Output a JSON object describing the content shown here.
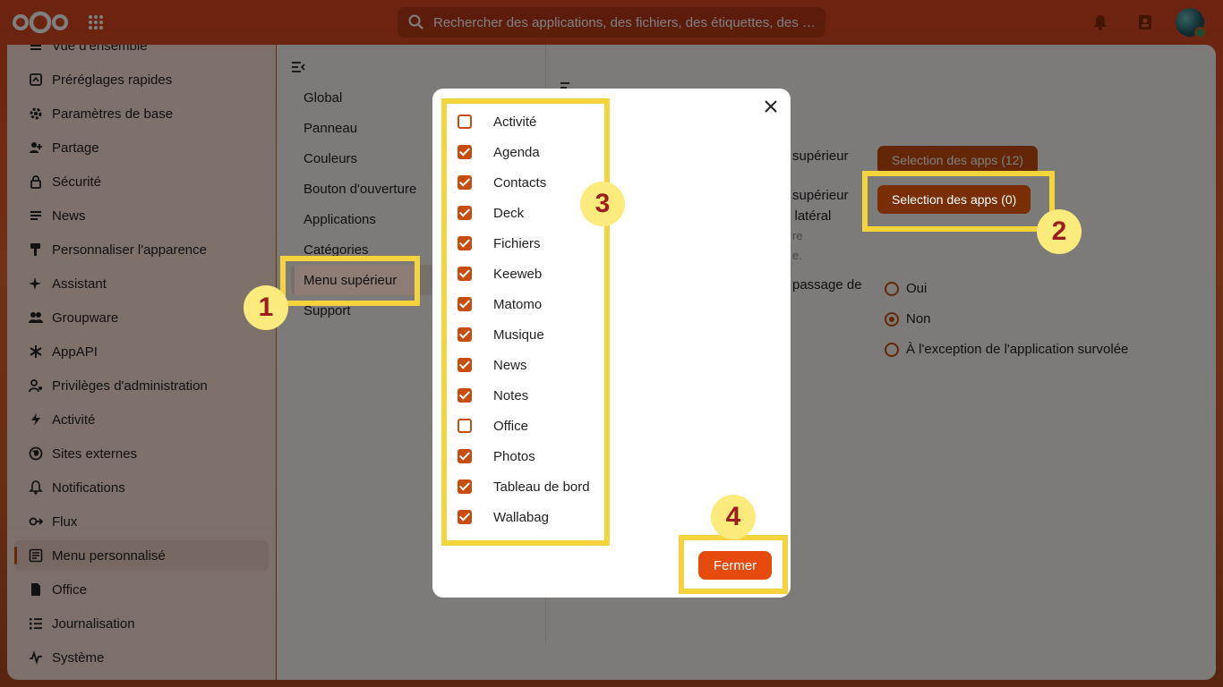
{
  "header": {
    "search_placeholder": "Rechercher des applications, des fichiers, des étiquettes, des …",
    "icons": [
      "nextcloud-logo",
      "apps-grid-icon",
      "search-icon",
      "notifications-icon",
      "contacts-icon",
      "user-avatar"
    ]
  },
  "sidebar": {
    "items": [
      {
        "label": "Vue d'ensemble",
        "icon": "list-icon"
      },
      {
        "label": "Préréglages rapides",
        "icon": "presets-icon"
      },
      {
        "label": "Paramètres de base",
        "icon": "gear-icon"
      },
      {
        "label": "Partage",
        "icon": "share-icon"
      },
      {
        "label": "Sécurité",
        "icon": "lock-icon"
      },
      {
        "label": "News",
        "icon": "news-icon"
      },
      {
        "label": "Personnaliser l'apparence",
        "icon": "paint-icon"
      },
      {
        "label": "Assistant",
        "icon": "sparkle-icon"
      },
      {
        "label": "Groupware",
        "icon": "group-icon"
      },
      {
        "label": "AppAPI",
        "icon": "api-icon"
      },
      {
        "label": "Privilèges d'administration",
        "icon": "admin-icon"
      },
      {
        "label": "Activité",
        "icon": "bolt-icon"
      },
      {
        "label": "Sites externes",
        "icon": "globe-icon"
      },
      {
        "label": "Notifications",
        "icon": "bell-icon"
      },
      {
        "label": "Flux",
        "icon": "flow-icon"
      },
      {
        "label": "Menu personnalisé",
        "icon": "menu-icon"
      },
      {
        "label": "Office",
        "icon": "document-icon"
      },
      {
        "label": "Journalisation",
        "icon": "log-icon"
      },
      {
        "label": "Système",
        "icon": "pulse-icon"
      }
    ],
    "active": "Menu personnalisé"
  },
  "settings_nav": {
    "items": [
      "Global",
      "Panneau",
      "Couleurs",
      "Bouton d'ouverture",
      "Applications",
      "Catégories",
      "Menu supérieur",
      "Support"
    ],
    "active": "Menu supérieur"
  },
  "content": {
    "row1_label": "supérieur",
    "row1_button": "Selection des apps (12)",
    "row2_label_a": "supérieur",
    "row2_label_b": "u latéral",
    "row2_sub_a": "re",
    "row2_sub_b": "e.",
    "row2_button": "Selection des apps (0)",
    "row3_label_a": "passage de",
    "radios": [
      {
        "label": "Oui",
        "checked": false
      },
      {
        "label": "Non",
        "checked": true
      },
      {
        "label": "À l'exception de l'application survolée",
        "checked": false
      }
    ]
  },
  "modal": {
    "apps": [
      {
        "label": "Activité",
        "checked": false
      },
      {
        "label": "Agenda",
        "checked": true
      },
      {
        "label": "Contacts",
        "checked": true
      },
      {
        "label": "Deck",
        "checked": true
      },
      {
        "label": "Fichiers",
        "checked": true
      },
      {
        "label": "Keeweb",
        "checked": true
      },
      {
        "label": "Matomo",
        "checked": true
      },
      {
        "label": "Musique",
        "checked": true
      },
      {
        "label": "News",
        "checked": true
      },
      {
        "label": "Notes",
        "checked": true
      },
      {
        "label": "Office",
        "checked": false
      },
      {
        "label": "Photos",
        "checked": true
      },
      {
        "label": "Tableau de bord",
        "checked": true
      },
      {
        "label": "Wallabag",
        "checked": true
      }
    ],
    "close_button": "Fermer"
  },
  "annotations": {
    "badge1": "1",
    "badge2": "2",
    "badge3": "3",
    "badge4": "4",
    "highlight_color": "#f5d33d"
  },
  "colors": {
    "accent": "#c74d0d",
    "close_button": "#e64a0c"
  }
}
